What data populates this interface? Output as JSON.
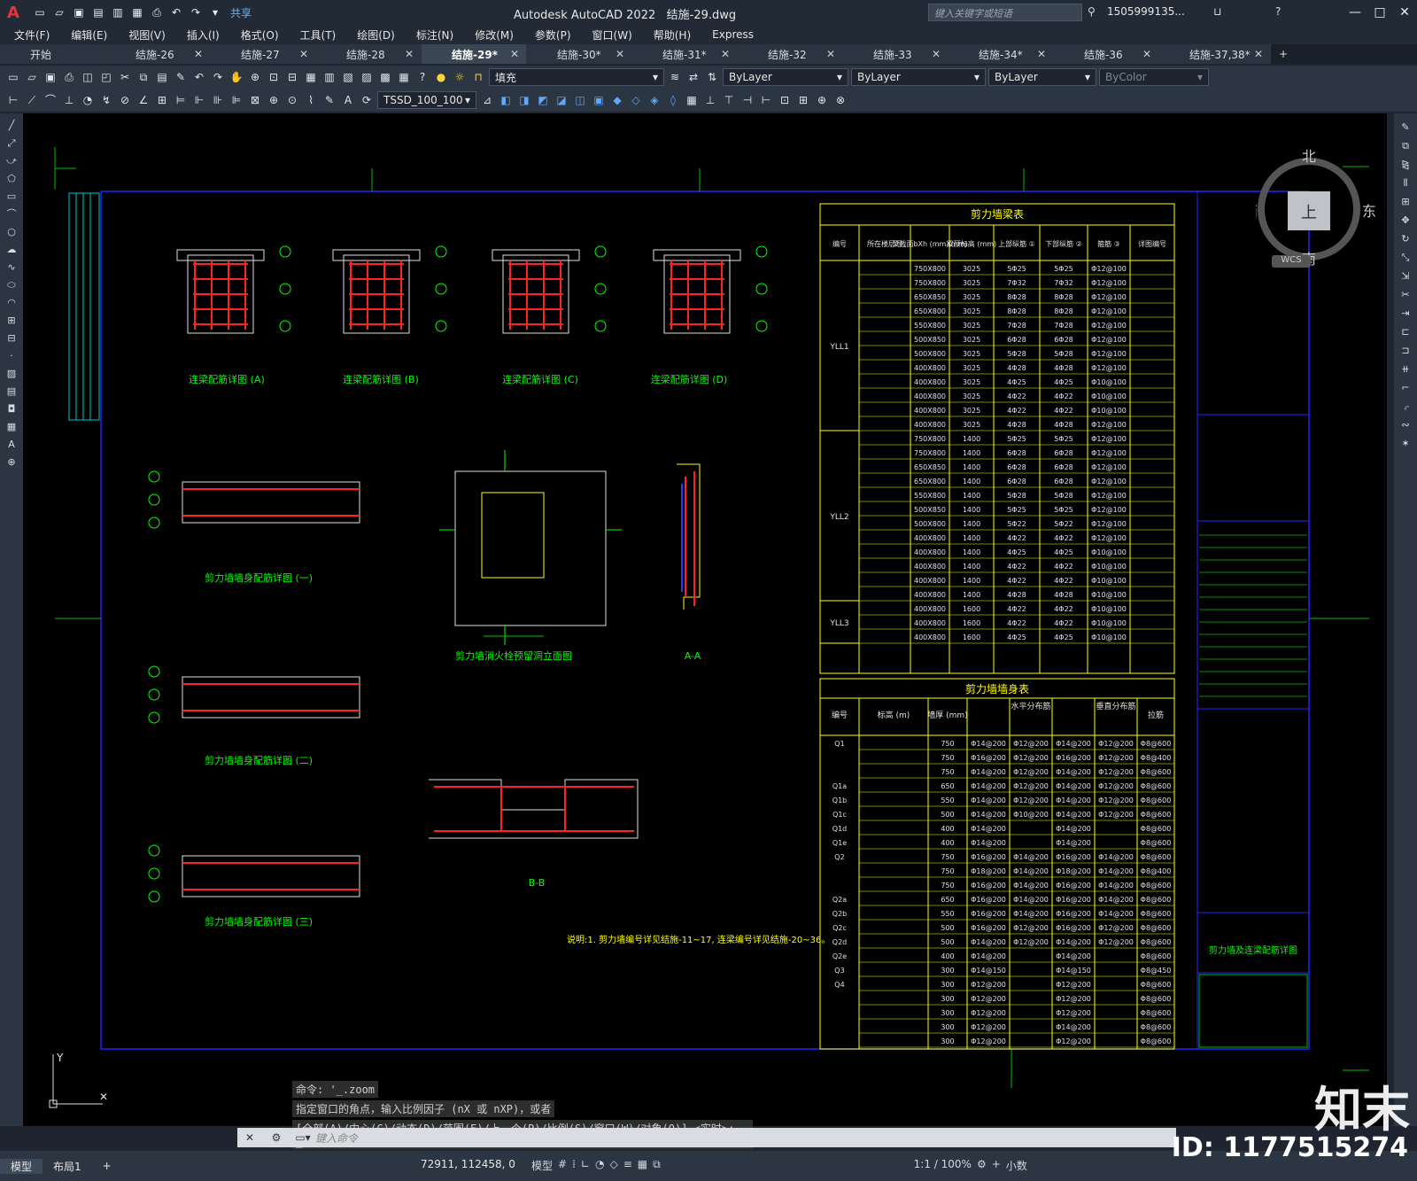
{
  "app": {
    "title": "Autodesk AutoCAD 2022",
    "document": "结施-29.dwg",
    "share_label": "共享",
    "search_placeholder": "键入关键字或短语",
    "user": "1505999135...",
    "logo": "A"
  },
  "menu": [
    "文件(F)",
    "编辑(E)",
    "视图(V)",
    "插入(I)",
    "格式(O)",
    "工具(T)",
    "绘图(D)",
    "标注(N)",
    "修改(M)",
    "参数(P)",
    "窗口(W)",
    "帮助(H)",
    "Express"
  ],
  "tabs": [
    {
      "label": "开始",
      "active": false
    },
    {
      "label": "结施-26",
      "active": false
    },
    {
      "label": "结施-27",
      "active": false
    },
    {
      "label": "结施-28",
      "active": false
    },
    {
      "label": "结施-29*",
      "active": true
    },
    {
      "label": "结施-30*",
      "active": false
    },
    {
      "label": "结施-31*",
      "active": false
    },
    {
      "label": "结施-32",
      "active": false
    },
    {
      "label": "结施-33",
      "active": false
    },
    {
      "label": "结施-34*",
      "active": false
    },
    {
      "label": "结施-36",
      "active": false
    },
    {
      "label": "结施-37,38*",
      "active": false
    }
  ],
  "toolbar": {
    "layer_combo": "填充",
    "color_combo": "ByLayer",
    "linetype_combo": "ByLayer",
    "lineweight_combo": "ByLayer",
    "plotstyle_combo": "ByColor",
    "textstyle_combo": "TSSD_100_100"
  },
  "viewcube": {
    "north": "北",
    "south": "南",
    "east": "东",
    "west": "西",
    "top": "上",
    "wcs": "WCS"
  },
  "command": {
    "history": [
      "命令: '_.zoom",
      "指定窗口的角点，输入比例因子 (nX 或 nXP)，或者",
      "[全部(A)/中心(C)/动态(D)/范围(E)/上一个(P)/比例(S)/窗口(W)/对象(O)] <实时>: _e"
    ],
    "placeholder": "键入命令"
  },
  "status": {
    "model_tab": "模型",
    "layout_tab": "布局1",
    "coords": "72911, 112458, 0",
    "space": "模型",
    "scale": "1:1 / 100%",
    "units": "小数"
  },
  "watermark": {
    "brand": "知末",
    "id": "ID: 1177515274"
  },
  "drawing": {
    "beam_table_title": "剪力墙梁表",
    "beam_headers": [
      "编号",
      "所在楼层号",
      "梁截面bXh (mmXmm)",
      "梁顶标高 (mm)",
      "上部纵筋 ①",
      "下部纵筋 ②",
      "箍筋 ③",
      "详图编号"
    ],
    "wall_table_title": "剪力墙墙身表",
    "wall_headers": [
      "编号",
      "标高 (m)",
      "墙厚 (mm)",
      "水平分布筋",
      "垂直分布筋",
      "拉筋"
    ],
    "beam_groups": [
      "YLL1",
      "YLL2",
      "YLL3"
    ],
    "beam_rows": [
      [
        "750X800",
        "3025",
        "5Φ25",
        "5Φ25",
        "Φ12@100"
      ],
      [
        "750X800",
        "3025",
        "7Φ32",
        "7Φ32",
        "Φ12@100"
      ],
      [
        "650X850",
        "3025",
        "8Φ28",
        "8Φ28",
        "Φ12@100"
      ],
      [
        "650X800",
        "3025",
        "8Φ28",
        "8Φ28",
        "Φ12@100"
      ],
      [
        "550X800",
        "3025",
        "7Φ28",
        "7Φ28",
        "Φ12@100"
      ],
      [
        "500X850",
        "3025",
        "6Φ28",
        "6Φ28",
        "Φ12@100"
      ],
      [
        "500X800",
        "3025",
        "5Φ28",
        "5Φ28",
        "Φ12@100"
      ],
      [
        "400X800",
        "3025",
        "4Φ28",
        "4Φ28",
        "Φ12@100"
      ],
      [
        "400X800",
        "3025",
        "4Φ25",
        "4Φ25",
        "Φ10@100"
      ],
      [
        "400X800",
        "3025",
        "4Φ22",
        "4Φ22",
        "Φ10@100"
      ],
      [
        "400X800",
        "3025",
        "4Φ22",
        "4Φ22",
        "Φ10@100"
      ],
      [
        "400X800",
        "3025",
        "4Φ28",
        "4Φ28",
        "Φ12@100"
      ],
      [
        "750X800",
        "1400",
        "5Φ25",
        "5Φ25",
        "Φ12@100"
      ],
      [
        "750X800",
        "1400",
        "6Φ28",
        "6Φ28",
        "Φ12@100"
      ],
      [
        "650X850",
        "1400",
        "6Φ28",
        "6Φ28",
        "Φ12@100"
      ],
      [
        "650X800",
        "1400",
        "6Φ28",
        "6Φ28",
        "Φ12@100"
      ],
      [
        "550X800",
        "1400",
        "5Φ28",
        "5Φ28",
        "Φ12@100"
      ],
      [
        "500X850",
        "1400",
        "5Φ25",
        "5Φ25",
        "Φ12@100"
      ],
      [
        "500X800",
        "1400",
        "5Φ22",
        "5Φ22",
        "Φ12@100"
      ],
      [
        "400X800",
        "1400",
        "4Φ22",
        "4Φ22",
        "Φ12@100"
      ],
      [
        "400X800",
        "1400",
        "4Φ25",
        "4Φ25",
        "Φ10@100"
      ],
      [
        "400X800",
        "1400",
        "4Φ22",
        "4Φ22",
        "Φ10@100"
      ],
      [
        "400X800",
        "1400",
        "4Φ22",
        "4Φ22",
        "Φ10@100"
      ],
      [
        "400X800",
        "1400",
        "4Φ28",
        "4Φ28",
        "Φ10@100"
      ],
      [
        "400X800",
        "1600",
        "4Φ22",
        "4Φ22",
        "Φ10@100"
      ],
      [
        "400X800",
        "1600",
        "4Φ22",
        "4Φ22",
        "Φ10@100"
      ],
      [
        "400X800",
        "1600",
        "4Φ25",
        "4Φ25",
        "Φ10@100"
      ]
    ],
    "wall_rows": [
      [
        "Q1",
        "750",
        "Φ14@200",
        "Φ12@200",
        "Φ14@200",
        "Φ12@200",
        "Φ8@600"
      ],
      [
        "",
        "750",
        "Φ16@200",
        "Φ12@200",
        "Φ16@200",
        "Φ12@200",
        "Φ8@400"
      ],
      [
        "",
        "750",
        "Φ14@200",
        "Φ12@200",
        "Φ14@200",
        "Φ12@200",
        "Φ8@600"
      ],
      [
        "Q1a",
        "650",
        "Φ14@200",
        "Φ12@200",
        "Φ14@200",
        "Φ12@200",
        "Φ8@600"
      ],
      [
        "Q1b",
        "550",
        "Φ14@200",
        "Φ12@200",
        "Φ14@200",
        "Φ12@200",
        "Φ8@600"
      ],
      [
        "Q1c",
        "500",
        "Φ14@200",
        "Φ10@200",
        "Φ14@200",
        "Φ12@200",
        "Φ8@600"
      ],
      [
        "Q1d",
        "400",
        "Φ14@200",
        "",
        "Φ14@200",
        "",
        "Φ8@600"
      ],
      [
        "Q1e",
        "400",
        "Φ14@200",
        "",
        "Φ14@200",
        "",
        "Φ8@600"
      ],
      [
        "Q2",
        "750",
        "Φ16@200",
        "Φ14@200",
        "Φ16@200",
        "Φ14@200",
        "Φ8@600"
      ],
      [
        "",
        "750",
        "Φ18@200",
        "Φ14@200",
        "Φ18@200",
        "Φ14@200",
        "Φ8@400"
      ],
      [
        "",
        "750",
        "Φ16@200",
        "Φ14@200",
        "Φ16@200",
        "Φ14@200",
        "Φ8@600"
      ],
      [
        "Q2a",
        "650",
        "Φ16@200",
        "Φ14@200",
        "Φ16@200",
        "Φ14@200",
        "Φ8@600"
      ],
      [
        "Q2b",
        "550",
        "Φ16@200",
        "Φ14@200",
        "Φ16@200",
        "Φ14@200",
        "Φ8@600"
      ],
      [
        "Q2c",
        "500",
        "Φ16@200",
        "Φ12@200",
        "Φ16@200",
        "Φ12@200",
        "Φ8@600"
      ],
      [
        "Q2d",
        "500",
        "Φ14@200",
        "Φ12@200",
        "Φ14@200",
        "Φ12@200",
        "Φ8@600"
      ],
      [
        "Q2e",
        "400",
        "Φ14@200",
        "",
        "Φ14@200",
        "",
        "Φ8@600"
      ],
      [
        "Q3",
        "300",
        "Φ14@150",
        "",
        "Φ14@150",
        "",
        "Φ8@450"
      ],
      [
        "Q4",
        "300",
        "Φ12@200",
        "",
        "Φ12@200",
        "",
        "Φ8@600"
      ],
      [
        "",
        "300",
        "Φ12@200",
        "",
        "Φ12@200",
        "",
        "Φ8@600"
      ],
      [
        "",
        "300",
        "Φ12@200",
        "",
        "Φ12@200",
        "",
        "Φ8@600"
      ],
      [
        "",
        "300",
        "Φ12@200",
        "",
        "Φ14@200",
        "",
        "Φ8@600"
      ],
      [
        "",
        "300",
        "Φ12@200",
        "",
        "Φ12@200",
        "",
        "Φ8@600"
      ]
    ],
    "detail_titles": [
      "连梁配筋详图 (A)",
      "连梁配筋详图 (B)",
      "连梁配筋详图 (C)",
      "连梁配筋详图 (D)",
      "剪力墙墙身配筋详图 (一)",
      "剪力墙消火栓预留洞立面图",
      "A-A",
      "剪力墙墙身配筋详图 (二)",
      "B-B",
      "剪力墙墙身配筋详图 (三)"
    ],
    "note": "说明:1. 剪力墙编号详见结施-11~17, 连梁编号详见结施-20~36。",
    "sheet_title": "剪力墙及连梁配筋详图"
  }
}
